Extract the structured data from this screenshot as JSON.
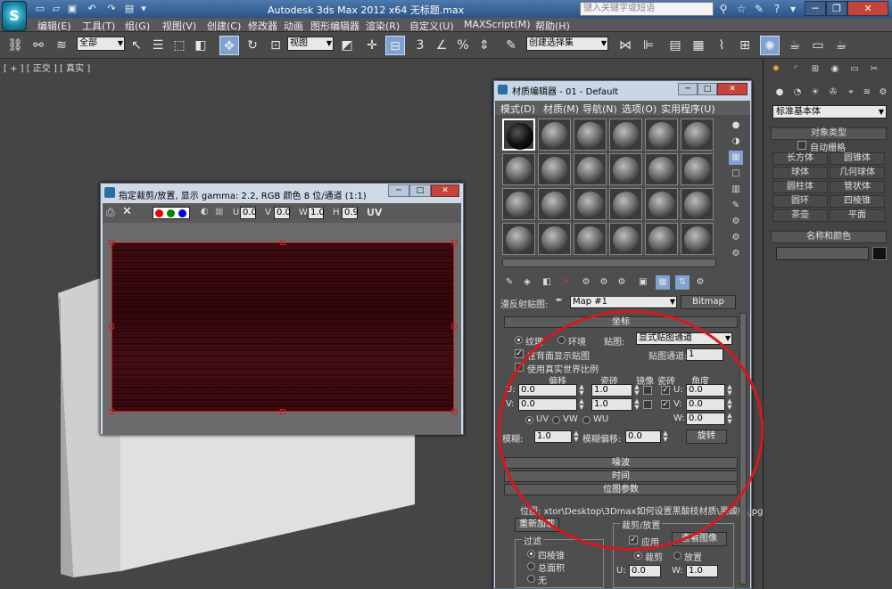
{
  "titlebar": {
    "app_logo": "S",
    "app_title": "Autodesk 3ds Max  2012 x64  无标题.max",
    "search_placeholder": "键入关键字或短语"
  },
  "menubar": {
    "items": [
      "编辑(E)",
      "工具(T)",
      "组(G)",
      "视图(V)",
      "创建(C)",
      "修改器",
      "动画",
      "图形编辑器",
      "渲染(R)",
      "自定义(U)",
      "MAXScript(M)",
      "帮助(H)"
    ]
  },
  "toolbar": {
    "selection_filter": "全部",
    "ref_coord": "视图",
    "named_selection": "创建选择集",
    "snap_label": "3",
    "percent_label": "%"
  },
  "viewport": {
    "label": "[ + ] [ 正交 ] [ 真实 ]"
  },
  "command_panel": {
    "geometry_type": "标准基本体",
    "object_type_title": "对象类型",
    "auto_grid": "自动栅格",
    "objects": [
      "长方体",
      "圆锥体",
      "球体",
      "几何球体",
      "圆柱体",
      "管状体",
      "圆环",
      "四棱锥",
      "茶壶",
      "平面"
    ],
    "name_color_title": "名称和颜色"
  },
  "texture_window": {
    "title": "指定裁剪/放置, 显示 gamma: 2.2, RGB 颜色 8 位/通道 (1:1)",
    "u_label": "U",
    "u_value": "0.0",
    "v_label": "V",
    "v_value": "0.0",
    "w_label": "W",
    "w_value": "1.0",
    "h_label": "H",
    "h_value": "0.9",
    "uv_label": "UV"
  },
  "material_editor": {
    "title": "材质编辑器 - 01 - Default",
    "menu": [
      "模式(D)",
      "材质(M)",
      "导航(N)",
      "选项(O)",
      "实用程序(U)"
    ],
    "map_label": "漫反射贴图:",
    "map_name": "Map #1",
    "map_type": "Bitmap",
    "coords_title": "坐标",
    "texture": "纹理",
    "environment": "环境",
    "mapping_label": "贴图:",
    "mapping_value": "显式贴图通道",
    "show_map_on_back": "在背面显示贴图",
    "map_channel_label": "贴图通道:",
    "map_channel_value": "1",
    "real_world": "使用真实世界比例",
    "offset": "偏移",
    "tiling": "瓷砖",
    "mirror": "镜像",
    "tile": "瓷砖",
    "angle": "角度",
    "u": "U:",
    "v": "V:",
    "w": "W:",
    "u_offset": "0.0",
    "u_tiling": "1.0",
    "v_offset": "0.0",
    "v_tiling": "1.0",
    "u_angle": "0.0",
    "v_angle": "0.0",
    "w_angle": "0.0",
    "uv": "UV",
    "vw": "VW",
    "wu": "WU",
    "blur_label": "模糊:",
    "blur_value": "1.0",
    "blur_offset_label": "模糊偏移:",
    "blur_offset_value": "0.0",
    "rotate": "旋转",
    "noise": "噪波",
    "time": "时间",
    "bitmap_params": "位图参数",
    "bitmap_path": "位图: xtor\\Desktop\\3Dmax如何设置黑酸枝材质\\黑酸枝.jpg",
    "reload": "重新加载",
    "crop_place": "裁剪/放置",
    "apply": "应用",
    "view_image": "查看图像",
    "filter": "过滤",
    "pyramidal": "四棱锥",
    "summed_area": "总面积",
    "none": "无",
    "crop": "裁剪",
    "place": "放置",
    "cu": "U:",
    "cu_value": "0.0",
    "cw": "W:",
    "cw_value": "1.0"
  },
  "colors": {
    "accent": "#7fa2d2",
    "annotation": "#d8181c",
    "wood": "#3a0c12"
  }
}
